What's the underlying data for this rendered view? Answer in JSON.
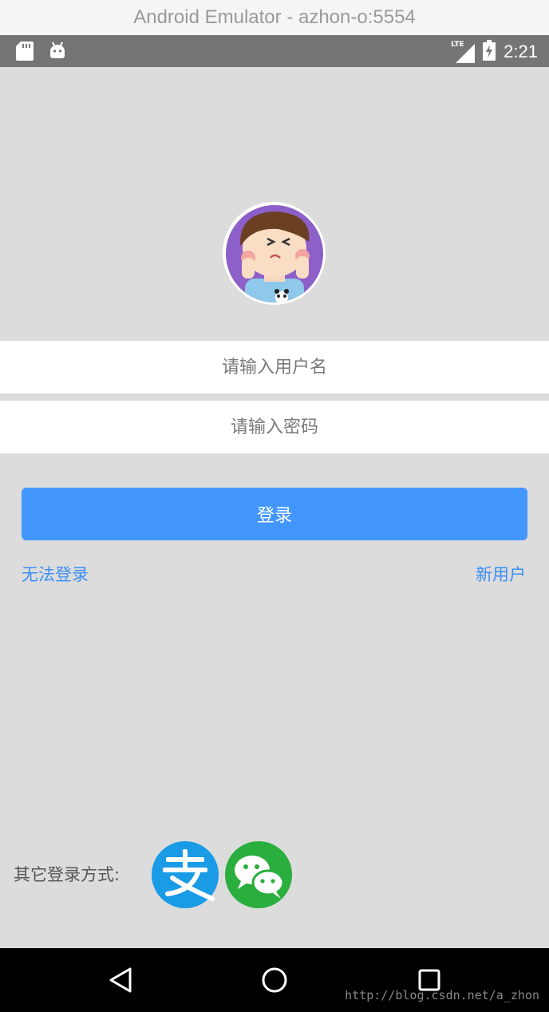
{
  "window": {
    "title": "Android Emulator - azhon-o:5554"
  },
  "status_bar": {
    "time": "2:21",
    "network": "LTE",
    "icons": [
      "sd-card-icon",
      "android-icon",
      "signal-icon",
      "battery-charging-icon"
    ]
  },
  "form": {
    "username_placeholder": "请输入用户名",
    "password_placeholder": "请输入密码",
    "login_label": "登录",
    "cannot_login_label": "无法登录",
    "new_user_label": "新用户"
  },
  "other_login": {
    "label": "其它登录方式:",
    "methods": [
      "alipay-icon",
      "wechat-icon"
    ]
  },
  "nav_bar": {
    "buttons": [
      "back-icon",
      "home-icon",
      "recents-icon"
    ]
  },
  "watermark": "http://blog.csdn.net/a_zhon",
  "colors": {
    "accent": "#4397fc",
    "link": "#3d8ff5",
    "background": "#dcdcdc",
    "alipay": "#1a9be6",
    "wechat": "#2aae3e"
  }
}
